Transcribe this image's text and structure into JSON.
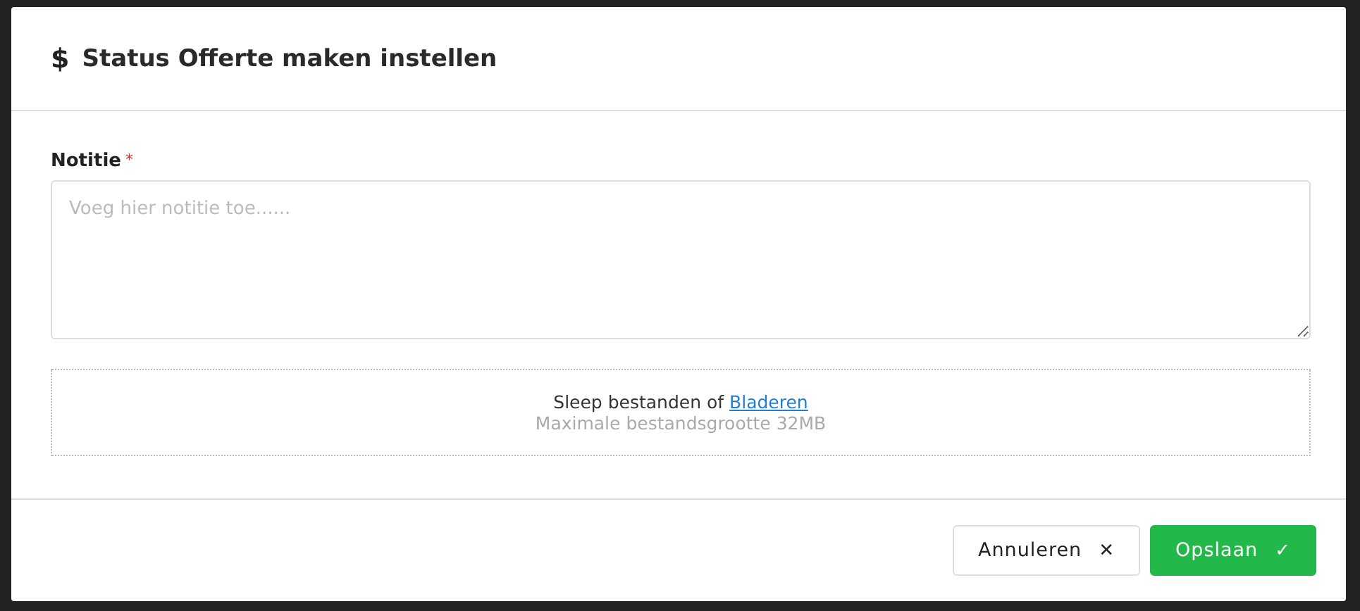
{
  "dialog": {
    "title_icon": "$",
    "title": "Status Offerte maken instellen"
  },
  "note": {
    "label": "Notitie",
    "required_mark": "*",
    "placeholder": "Voeg hier notitie toe......"
  },
  "dropzone": {
    "text": "Sleep bestanden of",
    "link": "Bladeren",
    "hint": "Maximale bestandsgrootte 32MB"
  },
  "buttons": [
    {
      "kind": "cancel",
      "label": "Annuleren",
      "icon": "✕"
    },
    {
      "kind": "save",
      "label": "Opslaan",
      "icon": "✓"
    }
  ]
}
